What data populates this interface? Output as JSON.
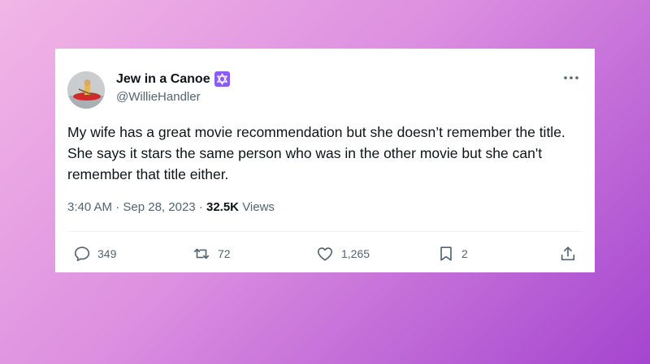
{
  "user": {
    "display_name": "Jew in a Canoe",
    "handle": "@WillieHandler",
    "badge_icon": "star-of-david-icon"
  },
  "tweet": {
    "text": "My wife has a great movie recommendation but she doesn’t remember the title. She says it stars the same person who was in the other movie but she can't remember that title either.",
    "time": "3:40 AM",
    "date": "Sep 28, 2023",
    "views_count": "32.5K",
    "views_label": "Views"
  },
  "actions": {
    "replies": "349",
    "retweets": "72",
    "likes": "1,265",
    "bookmarks": "2"
  },
  "colors": {
    "badge": "#8a5cf5",
    "text": "#0f1419",
    "muted": "#536471"
  }
}
